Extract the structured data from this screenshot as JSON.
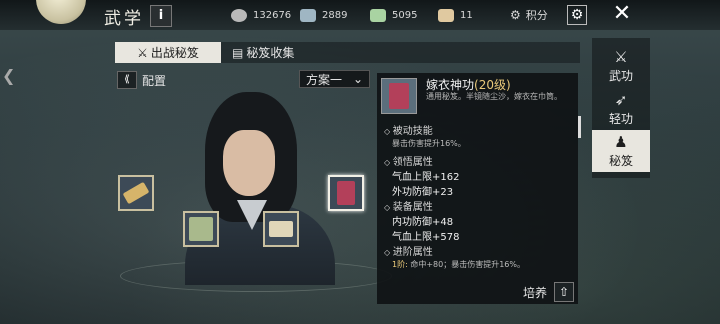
{
  "topbar": {
    "title": "武学",
    "info_label": "i",
    "resources": [
      {
        "icon": "coin-icon",
        "value": "132676",
        "color": "#c8c8c8"
      },
      {
        "icon": "ingot-icon",
        "value": "2889",
        "color": "#9fb6c3"
      },
      {
        "icon": "jade-icon",
        "value": "5095",
        "color": "#a9d3a2"
      },
      {
        "icon": "scroll-token-icon",
        "value": "11",
        "color": "#e0c9a0"
      }
    ],
    "points_label": "积分",
    "close_label": "✕"
  },
  "tabs": [
    {
      "label": "出战秘笈",
      "icon": "sword-icon",
      "glyph": "⚔",
      "active": true
    },
    {
      "label": "秘笈收集",
      "icon": "book-icon",
      "glyph": "▤",
      "active": false
    }
  ],
  "config": {
    "label": "配置",
    "icon_glyph": "⟪"
  },
  "scheme_select": {
    "value": "方案一",
    "arrow": "⌄"
  },
  "slots": [
    {
      "name": "slot-scroll-left",
      "color": "#d6b46a",
      "selected": false
    },
    {
      "name": "slot-fan",
      "color": "#a9b98c",
      "selected": false
    },
    {
      "name": "slot-open-book",
      "color": "#e0d6b8",
      "selected": false
    },
    {
      "name": "slot-red-book",
      "color": "#b3405a",
      "selected": true
    }
  ],
  "detail": {
    "name": "嫁衣神功",
    "level": "(20级)",
    "description": "通用秘笈。半镜随尘沙，嫁衣在巾筒。",
    "passive_title": "被动技能",
    "passive_text": "暴击伤害提升16%。",
    "insight_title": "领悟属性",
    "insight_lines": [
      "气血上限+162",
      "外功防御+23"
    ],
    "equip_title": "装备属性",
    "equip_lines": [
      "内功防御+48",
      "气血上限+578"
    ],
    "advance_title": "进阶属性",
    "advance_tier": "1阶:",
    "advance_text": " 命中+80；暴击伤害提升16%。",
    "train_label": "培养",
    "train_glyph": "⇧"
  },
  "right_nav": [
    {
      "label": "武功",
      "icon": "martial-icon",
      "glyph": "⚔",
      "active": false
    },
    {
      "label": "轻功",
      "icon": "lightness-icon",
      "glyph": "➶",
      "active": false
    },
    {
      "label": "秘笈",
      "icon": "meditation-icon",
      "glyph": "♟",
      "active": true
    }
  ]
}
